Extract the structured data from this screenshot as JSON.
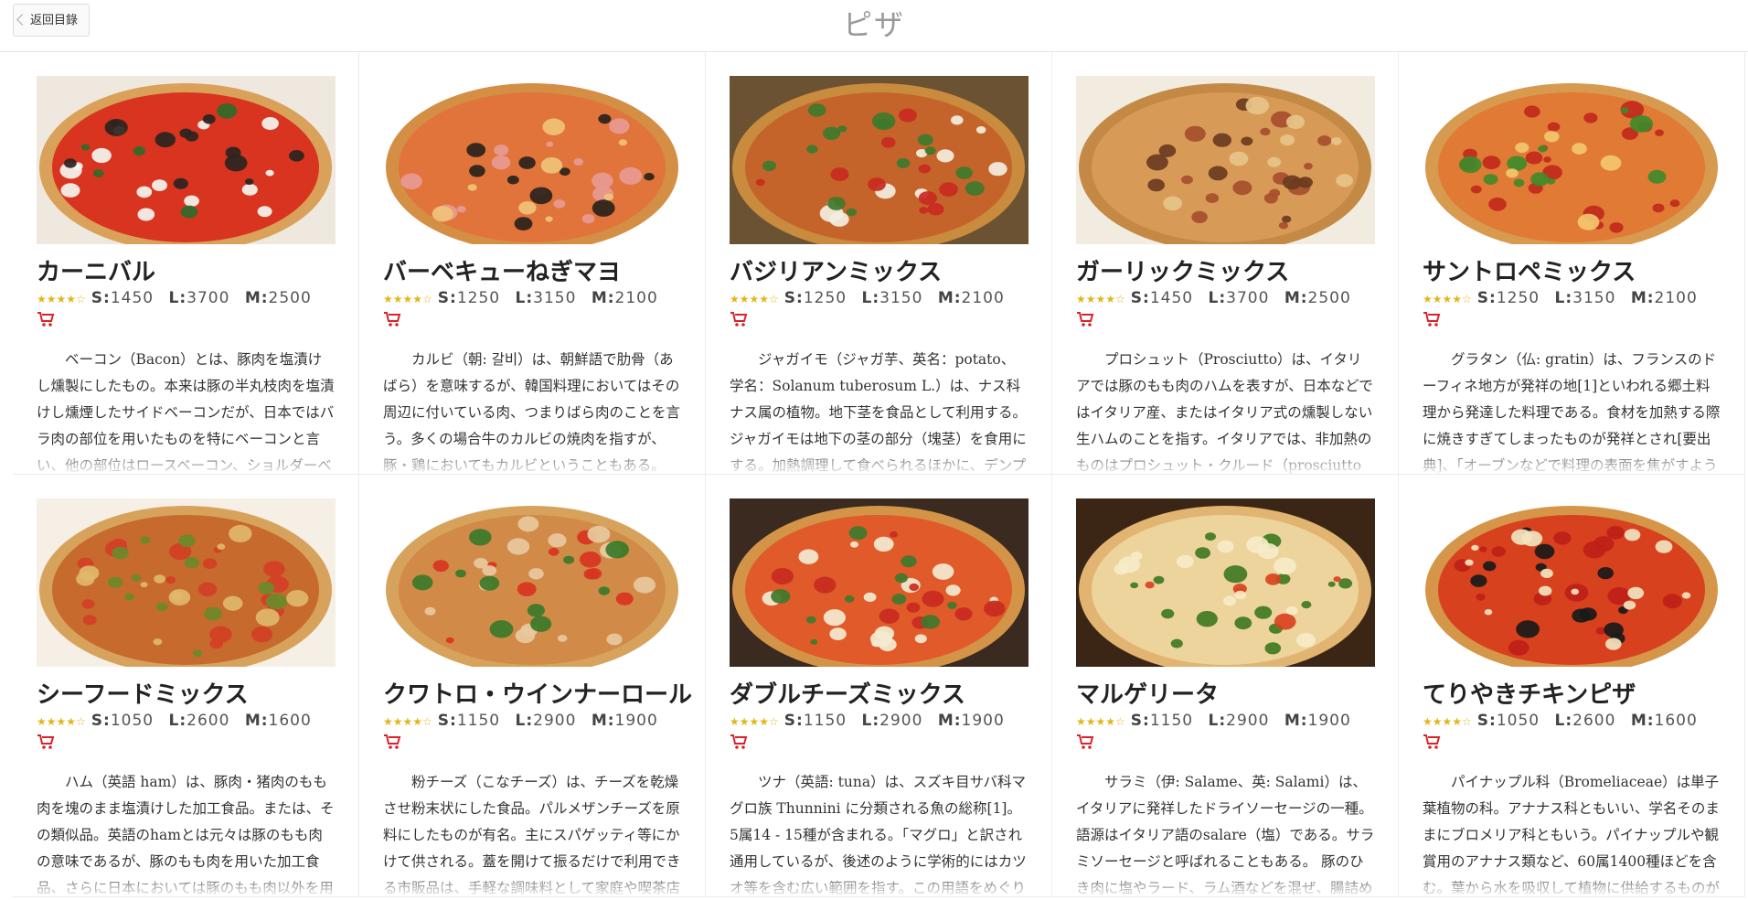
{
  "header": {
    "back_label": "返回目錄",
    "title": "ピザ"
  },
  "price_labels": {
    "s": "S:",
    "l": "L:",
    "m": "M:"
  },
  "items": [
    {
      "name": "カーニバル",
      "rating": 4,
      "s": "1450",
      "l": "3700",
      "m": "2500",
      "desc": "ベーコン（Bacon）とは、豚肉を塩漬けし燻製にしたもの。本来は豚の半丸枝肉を塩漬けし燻煙したサイドベーコンだが、日本ではバラ肉の部位を用いたものを特にベーコンと言い、他の部位はロースベーコン、ショルダーベーコン",
      "image": "pizza-caprese"
    },
    {
      "name": "バーベキューねぎマヨ",
      "rating": 4,
      "s": "1250",
      "l": "3150",
      "m": "2100",
      "desc": "カルビ（朝: 갈비）は、朝鮮語で肋骨（あばら）を意味するが、韓国料理においてはその周辺に付いている肉、つまりばら肉のことを言う。多くの場合牛のカルビの焼肉を指すが、豚・鶏においてもカルビということもある。　韓国で",
      "image": "pizza-ham"
    },
    {
      "name": "バジリアンミックス",
      "rating": 4,
      "s": "1250",
      "l": "3150",
      "m": "2100",
      "desc": "ジャガイモ（ジャガ芋、英名：potato、学名：Solanum tuberosum L.）は、ナス科ナス属の植物。地下茎を食品として利用する。 ジャガイモは地下の茎の部分（塊茎）を食用にする。加熱調理して食べられるほかに、デンプン",
      "image": "pizza-salad"
    },
    {
      "name": "ガーリックミックス",
      "rating": 4,
      "s": "1450",
      "l": "3700",
      "m": "2500",
      "desc": "プロシュット（Prosciutto）は、イタリアでは豚のもも肉のハムを表すが、日本などではイタリア産、またはイタリア式の燻製しない生ハムのことを指す。イタリアでは、非加熱のものはプロシュット・クルード（prosciutto crudo）、加",
      "image": "pizza-garlic"
    },
    {
      "name": "サントロペミックス",
      "rating": 4,
      "s": "1250",
      "l": "3150",
      "m": "2100",
      "desc": "グラタン（仏: gratin）は、フランスのドーフィネ地方が発祥の地[1]といわれる郷土料理から発達した料理である。食材を加熱する際に焼きすぎてしまったものが発祥とされ[要出典]、「オーブンなどで料理の表面を焦がすよう",
      "image": "pizza-pepperoni"
    },
    {
      "name": "シーフードミックス",
      "rating": 4,
      "s": "1050",
      "l": "2600",
      "m": "1600",
      "desc": "ハム（英語 ham）は、豚肉・猪肉のもも肉を塊のまま塩漬けした加工食品。または、その類似品。英語のhamとは元々は豚のもも肉の意味であるが、豚のもも肉を用いた加工食品、さらに日本においては豚のもも肉以外を用いた",
      "image": "pizza-seafood"
    },
    {
      "name": "クワトロ・ウインナーロール",
      "rating": 4,
      "s": "1150",
      "l": "2900",
      "m": "1900",
      "desc": "粉チーズ（こなチーズ）は、チーズを乾燥させ粉末状にした食品。パルメザンチーズを原料にしたものが有名。主にスパゲッティ等にかけて供される。蓋を開けて振るだけで利用できる市販品は、手軽な調味料として家庭や喫茶店",
      "image": "pizza-tuna"
    },
    {
      "name": "ダブルチーズミックス",
      "rating": 4,
      "s": "1150",
      "l": "2900",
      "m": "1900",
      "desc": "ツナ（英語: tuna）は、スズキ目サバ科マグロ族 Thunnini に分類される魚の総称[1]。5属14 - 15種が含まれる。「マグロ」と訳され通用しているが、後述のように学術的にはカツオ等を含む広い範囲を指す。この用語をめぐり日",
      "image": "pizza-cheese"
    },
    {
      "name": "マルゲリータ",
      "rating": 4,
      "s": "1150",
      "l": "2900",
      "m": "1900",
      "desc": "サラミ（伊: Salame、英: Salami）は、イタリアに発祥したドライソーセージの一種。語源はイタリア語のsalare（塩）である。サラミソーセージと呼ばれることもある。 豚のひき肉に塩やラード、ラム酒などを混ぜ、腸詰めして、塩",
      "image": "pizza-margherita"
    },
    {
      "name": "てりやきチキンピザ",
      "rating": 4,
      "s": "1050",
      "l": "2600",
      "m": "1600",
      "desc": "パイナップル科（Bromeliaceae）は単子葉植物の科。アナナス科ともいい、学名そのままにブロメリア科ともいう。パイナップルや観賞用のアナナス類など、60属1400種ほどを含む。葉から水を吸収して植物に供給するものが",
      "image": "pizza-teriyaki"
    }
  ],
  "colors": {
    "title": "#999999",
    "stars": "#e2b51a",
    "cart": "#d9232b",
    "border": "#ececec"
  }
}
